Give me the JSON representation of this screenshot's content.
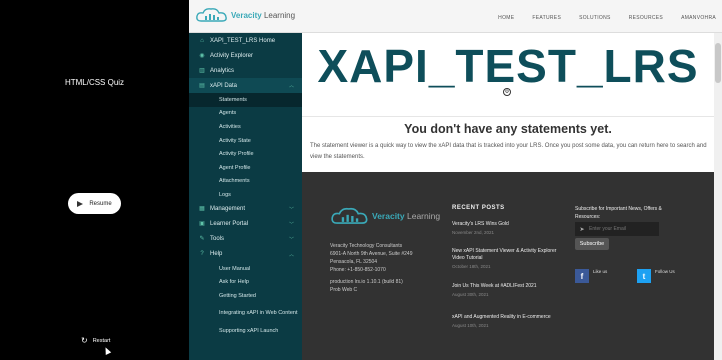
{
  "quiz": {
    "title": "HTML/CSS Quiz",
    "resume_label": "Resume",
    "restart_label": "Restart"
  },
  "topbar": {
    "logo_main": "Veracity",
    "logo_sub": "Learning",
    "nav": [
      "HOME",
      "FEATURES",
      "SOLUTIONS",
      "RESOURCES",
      "AMANVOHRA"
    ]
  },
  "sidebar": {
    "home": "XAPI_TEST_LRS Home",
    "activity_explorer": "Activity Explorer",
    "analytics": "Analytics",
    "xapi_data": "xAPI Data",
    "xapi_sub": [
      "Statements",
      "Agents",
      "Activities",
      "Activity State",
      "Activity Profile",
      "Agent Profile",
      "Attachments",
      "Logs"
    ],
    "management": "Management",
    "learner_portal": "Learner Portal",
    "tools": "Tools",
    "help": "Help",
    "help_sub": [
      "User Manual",
      "Ask for Help",
      "Getting Started",
      "Integrating xAPI in Web Content",
      "Supporting xAPI Launch"
    ]
  },
  "main": {
    "hero_title": "XAPI_TEST_LRS",
    "empty_title": "You don't have any statements yet.",
    "empty_desc": "The statement viewer is a quick way to view the xAPI data that is tracked into your LRS. Once you post some data, you can return here to search and view the statements."
  },
  "footer": {
    "logo_main": "Veracity",
    "logo_sub": "Learning",
    "address": [
      "Veracity Technology Consultants",
      "6901-A North 9th Avenue, Suite #249",
      "Pensacola, FL 32504",
      "Phone: +1-850-852-1070"
    ],
    "version": [
      "production lrs.io 1.10.1 (build 81)",
      "Prob Web C"
    ],
    "recent_title": "RECENT POSTS",
    "posts": [
      {
        "title": "Veracity's LRS Wins Gold",
        "date": "November 2nd, 2021"
      },
      {
        "title": "New xAPI Statement Viewer & Activity Explorer Video Tutorial",
        "date": "October 18th, 2021"
      },
      {
        "title": "Join Us This Week at #ADLIFest 2021",
        "date": "August 30th, 2021"
      },
      {
        "title": "xAPI and Augmented Reality in E-commerce",
        "date": "August 10th, 2021"
      }
    ],
    "subscribe_title": "Subscribe for Important News, Offers & Resources:",
    "email_placeholder": "Enter your Email",
    "subscribe_btn": "Subscribe",
    "like_us": "Like us",
    "follow_us": "Follow Us"
  },
  "colors": {
    "sidebar_bg": "#0b3b44",
    "brand_teal": "#3aa9b8",
    "hero_title": "#0e4e5a",
    "footer_bg": "#323232",
    "facebook": "#3b5998",
    "twitter": "#1da1f2"
  }
}
